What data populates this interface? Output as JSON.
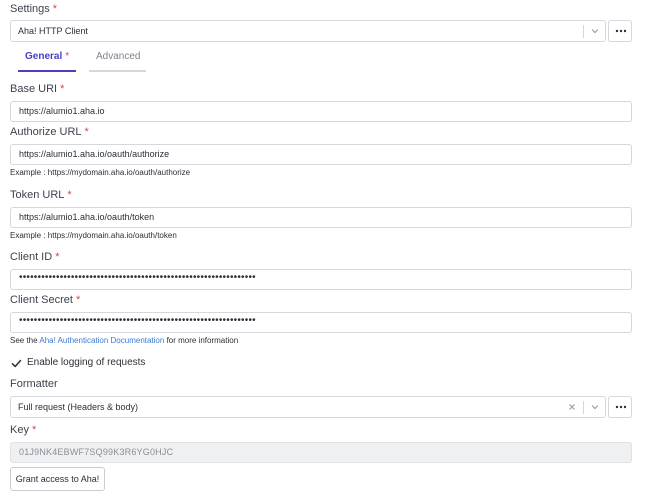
{
  "settings": {
    "label": "Settings",
    "required_mark": "*",
    "selected": "Aha! HTTP Client"
  },
  "tabs": [
    {
      "label": "General",
      "required_mark": "*",
      "active": true
    },
    {
      "label": "Advanced",
      "active": false
    }
  ],
  "fields": {
    "base_uri": {
      "label": "Base URI",
      "required_mark": "*",
      "value": "https://alumio1.aha.io"
    },
    "authorize_url": {
      "label": "Authorize URL",
      "required_mark": "*",
      "value": "https://alumio1.aha.io/oauth/authorize",
      "hint": "Example : https://mydomain.aha.io/oauth/authorize"
    },
    "token_url": {
      "label": "Token URL",
      "required_mark": "*",
      "value": "https://alumio1.aha.io/oauth/token",
      "hint": "Example : https://mydomain.aha.io/oauth/token"
    },
    "client_id": {
      "label": "Client ID",
      "required_mark": "*",
      "value": "••••••••••••••••••••••••••••••••••••••••••••••••••••••••••••••••"
    },
    "client_secret": {
      "label": "Client Secret",
      "required_mark": "*",
      "value": "••••••••••••••••••••••••••••••••••••••••••••••••••••••••••••••••",
      "hint_prefix": "See the ",
      "hint_link": "Aha! Authentication Documentation",
      "hint_suffix": " for more information"
    }
  },
  "logging": {
    "label": "Enable logging of requests",
    "checked": true
  },
  "formatter": {
    "label": "Formatter",
    "selected": "Full request (Headers & body)"
  },
  "key": {
    "label": "Key",
    "required_mark": "*",
    "value": "01J9NK4EBWF7SQ99K3R6YG0HJC"
  },
  "grant_button": {
    "label": "Grant access to Aha!"
  },
  "colors": {
    "accent": "#4a3fc4",
    "required": "#e04545",
    "link": "#3b7bd4"
  }
}
